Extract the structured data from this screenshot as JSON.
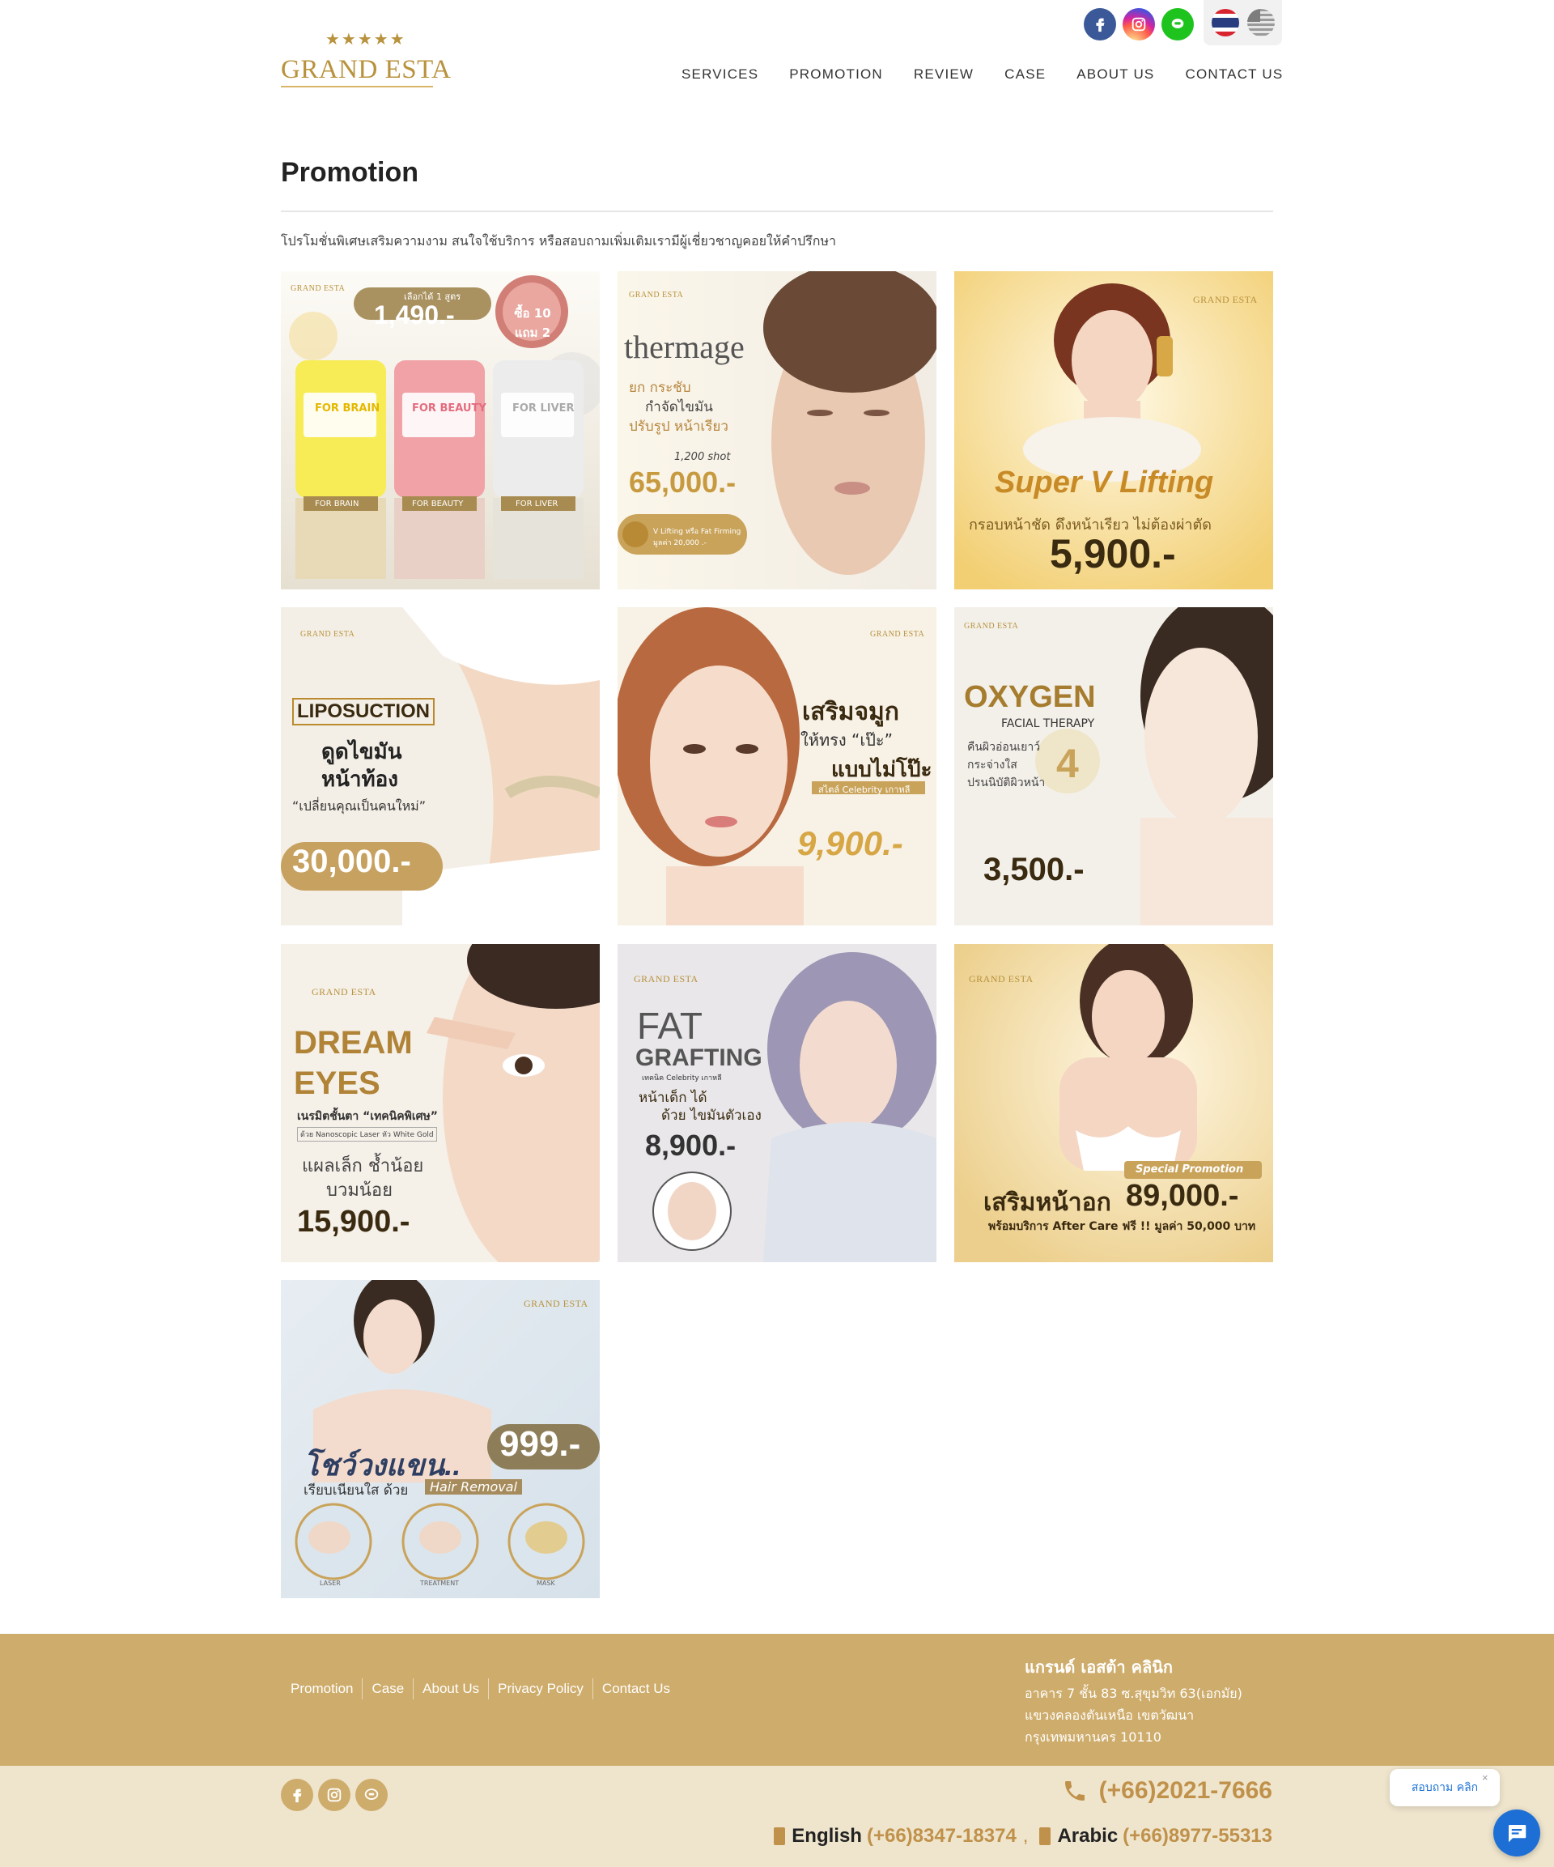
{
  "brand": {
    "logo_text": "GRAND ESTA",
    "logo_stars": "★★★★★"
  },
  "header": {
    "social": [
      "facebook-icon",
      "instagram-icon",
      "line-icon"
    ],
    "languages": [
      "thai-flag",
      "us-flag"
    ],
    "nav": [
      "SERVICES",
      "PROMOTION",
      "REVIEW",
      "CASE",
      "ABOUT US",
      "CONTACT US"
    ]
  },
  "page": {
    "title": "Promotion",
    "intro": "โปรโมชั่นพิเศษเสริมความงาม สนใจใช้บริการ หรือสอบถามเพิ่มเติมเรามีผู้เชี่ยวชาญคอยให้คำปรึกษา"
  },
  "promotions": [
    {
      "brand": "GRAND ESTA",
      "headline": "1,490.-",
      "line1": "เลือกได้ 1 สูตร",
      "line2": "ซื้อ 10 แถม 2",
      "tags": [
        "FOR BRAIN",
        "FOR BEAUTY",
        "FOR LIVER"
      ]
    },
    {
      "brand": "GRAND ESTA",
      "headline": "thermage",
      "line1": "ยก กระชับ",
      "line2": "กำจัดไขมัน",
      "line3": "ปรับรูป หน้าเรียว",
      "line4": "1,200 shot",
      "price": "65,000.-",
      "badge": "V Lifting หรือ Fat Firming มูลค่า 20,000 .-"
    },
    {
      "brand": "GRAND ESTA",
      "headline": "Super V Lifting",
      "line1": "กรอบหน้าชัด ดึงหน้าเรียว ไม่ต้องผ่าตัด",
      "price": "5,900.-"
    },
    {
      "brand": "GRAND ESTA",
      "headline": "LIPOSUCTION",
      "line1": "ดูดไขมัน",
      "line2": "หน้าท้อง",
      "line3": "“เปลี่ยนคุณเป็นคนใหม่”",
      "price": "30,000.-"
    },
    {
      "brand": "GRAND ESTA",
      "headline": "เสริมจมูก",
      "line1": "ให้ทรง “เป๊ะ”",
      "line2": "แบบไม่โป๊ะ",
      "line3": "สไตล์ Celebrity เกาหลี",
      "price": "9,900.-"
    },
    {
      "brand": "GRAND ESTA",
      "headline": "OXYGEN",
      "line1": "FACIAL THERAPY",
      "line2": "คืนผิวอ่อนเยาว์",
      "line3": "กระจ่างใส",
      "line4": "ปรนนิบัติผิวหน้า",
      "count": "4",
      "price": "3,500.-"
    },
    {
      "brand": "GRAND ESTA",
      "headline": "DREAM",
      "headline2": "EYES",
      "line1": "เนรมิตชั้นตา “เทคนิคพิเศษ”",
      "line2": "ด้วย Nanoscopic Laser หัว White Gold",
      "line3": "แผลเล็ก ช้ำน้อย",
      "line4": "บวมน้อย",
      "price": "15,900.-"
    },
    {
      "brand": "GRAND ESTA",
      "headline": "FAT",
      "headline2": "GRAFTING",
      "line1": "เทคนิค Celebrity เกาหลี",
      "line2": "หน้าเด็ก ได้",
      "line3": "ด้วย ไขมันตัวเอง",
      "price": "8,900.-"
    },
    {
      "brand": "GRAND ESTA",
      "headline": "เสริมหน้าอก",
      "tag": "Special Promotion",
      "line1": "พร้อมบริการ After Care ฟรี !! มูลค่า 50,000 บาท",
      "price": "89,000.-"
    },
    {
      "brand": "GRAND ESTA",
      "headline": "โชว์วงแขน..",
      "line1": "เรียบเนียนใส ด้วย",
      "line2": "Hair Removal",
      "price": "999.-",
      "steps": [
        "LASER",
        "TREATMENT",
        "MASK"
      ]
    }
  ],
  "footer": {
    "links": [
      "Promotion",
      "Case",
      "About Us",
      "Privacy Policy",
      "Contact Us"
    ],
    "clinic_name": "แกรนด์ เอสต้า คลินิก",
    "address": [
      "อาคาร 7 ชั้น 83 ซ.สุขุมวิท 63(เอกมัย)",
      "แขวงคลองตันเหนือ เขตวัฒนา",
      "กรุงเทพมหานคร 10110"
    ],
    "phone_main": "(+66)2021-7666",
    "english_label": "English",
    "english_phone": "(+66)8347-18374",
    "separator": ",",
    "arabic_label": "Arabic",
    "arabic_phone": "(+66)8977-55313"
  },
  "chat": {
    "bubble": "สอบถาม คลิก",
    "close": "×"
  },
  "colors": {
    "gold": "#ceac6b",
    "gold_text": "#c0914a",
    "footer_light": "#efe5cd",
    "chat_blue": "#1d6fd6"
  }
}
